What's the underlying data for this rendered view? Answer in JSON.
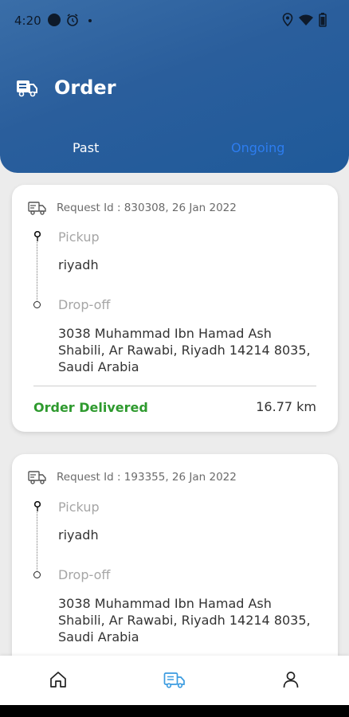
{
  "status_bar": {
    "time": "4:20"
  },
  "header": {
    "title": "Order",
    "tabs": [
      {
        "label": "Past",
        "active": false
      },
      {
        "label": "Ongoing",
        "active": true
      }
    ],
    "tab_active_color": "#2d7df0"
  },
  "orders": [
    {
      "request": "Request Id : 830308, 26 Jan 2022",
      "pickup_label": "Pickup",
      "pickup": "riyadh",
      "dropoff_label": "Drop-off",
      "dropoff": "3038 Muhammad Ibn Hamad Ash Shabili, Ar Rawabi, Riyadh 14214 8035, Saudi Arabia",
      "status": "Order Delivered",
      "distance": "16.77 km"
    },
    {
      "request": "Request Id : 193355, 26 Jan 2022",
      "pickup_label": "Pickup",
      "pickup": "riyadh",
      "dropoff_label": "Drop-off",
      "dropoff": "3038 Muhammad Ibn Hamad Ash Shabili, Ar Rawabi, Riyadh 14214 8035, Saudi Arabia"
    }
  ],
  "bottom_nav": [
    {
      "icon": "home-icon",
      "active": false
    },
    {
      "icon": "orders-truck-icon",
      "active": true
    },
    {
      "icon": "profile-icon",
      "active": false
    }
  ],
  "colors": {
    "header": "#2a5e9c",
    "delivered": "#2e9a2e",
    "nav_active": "#3a9be0"
  }
}
